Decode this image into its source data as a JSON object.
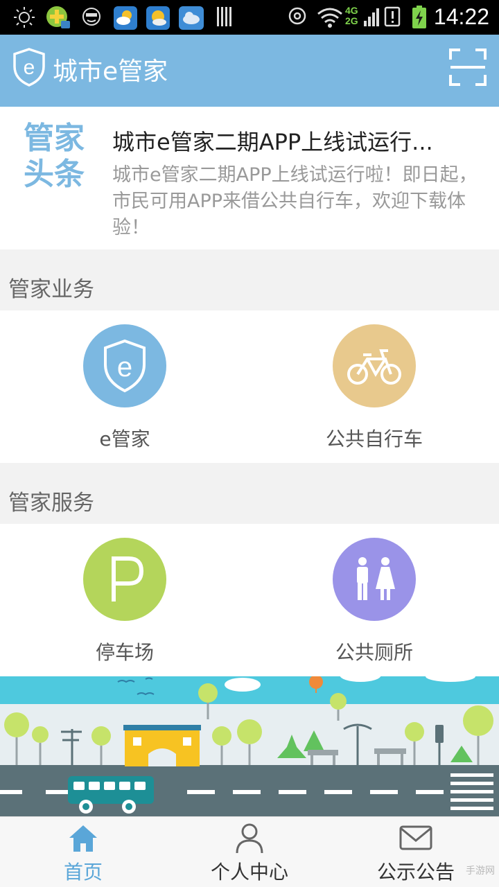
{
  "status_bar": {
    "time": "14:22",
    "network_top": "4G",
    "network_bottom": "2G"
  },
  "app": {
    "title": "城市e管家",
    "scan_icon": "scan-frame-icon"
  },
  "headline": {
    "badge_line1": "管家",
    "badge_line2": "头条",
    "title": "城市e管家二期APP上线试运行...",
    "body": "城市e管家二期APP上线试运行啦！即日起，市民可用APP来借公共自行车，欢迎下载体验！"
  },
  "business": {
    "section_title": "管家业务",
    "items": [
      {
        "label": "e管家",
        "icon": "shield-e-icon",
        "color": "#7cb8e1"
      },
      {
        "label": "公共自行车",
        "icon": "bicycle-icon",
        "color": "#e8c98d"
      }
    ]
  },
  "services": {
    "section_title": "管家服务",
    "items": [
      {
        "label": "停车场",
        "icon": "parking-icon",
        "glyph": "P",
        "color": "#b4d55b"
      },
      {
        "label": "公共厕所",
        "icon": "restroom-icon",
        "color": "#9a93e8"
      }
    ]
  },
  "tabs": [
    {
      "label": "首页",
      "icon": "home-icon",
      "active": true
    },
    {
      "label": "个人中心",
      "icon": "person-icon",
      "active": false
    },
    {
      "label": "公示公告",
      "icon": "mail-icon",
      "active": false
    }
  ],
  "watermark": "手游网",
  "colors": {
    "accent": "#7cb8e1",
    "active_tab": "#5aa6d8"
  }
}
